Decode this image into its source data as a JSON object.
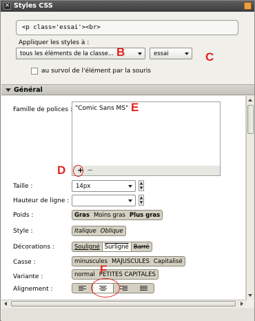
{
  "window": {
    "title": "Styles CSS"
  },
  "selector": {
    "value": "<p class='essai'><br>"
  },
  "apply": {
    "label": "Appliquer les styles à :",
    "scope_value": "tous les éléments de la classe...",
    "class_value": "essai",
    "hover_label": "au survol de l'élément par la souris",
    "hover_checked": false
  },
  "section": {
    "title": "Général"
  },
  "fields": {
    "font_family_label": "Famille de polices :",
    "font_family_value": "\"Comic Sans MS\"",
    "add_label": "+",
    "remove_label": "−",
    "size_label": "Taille :",
    "size_value": "14px",
    "line_height_label": "Hauteur de ligne :",
    "line_height_value": "",
    "weight_label": "Poids :",
    "weight_options": [
      "Gras",
      "Moins gras",
      "Plus gras"
    ],
    "style_label": "Style :",
    "style_options": [
      "Italique",
      "Oblique"
    ],
    "decoration_label": "Décorations :",
    "decoration_options": [
      "Souligné",
      "Surligné",
      "Barré"
    ],
    "case_label": "Casse :",
    "case_options": [
      "minuscules",
      "MAJUSCULES",
      "Capitalisé"
    ],
    "variant_label": "Variante :",
    "variant_options": [
      "normal",
      "PETITES CAPITALES"
    ],
    "align_label": "Alignement :",
    "align_selected": "center"
  },
  "annotations": {
    "b": "B",
    "c": "C",
    "d": "D",
    "e": "E",
    "f": "F"
  },
  "colors": {
    "annotation": "#e0231e",
    "titlebar": "#4a4a4a"
  }
}
